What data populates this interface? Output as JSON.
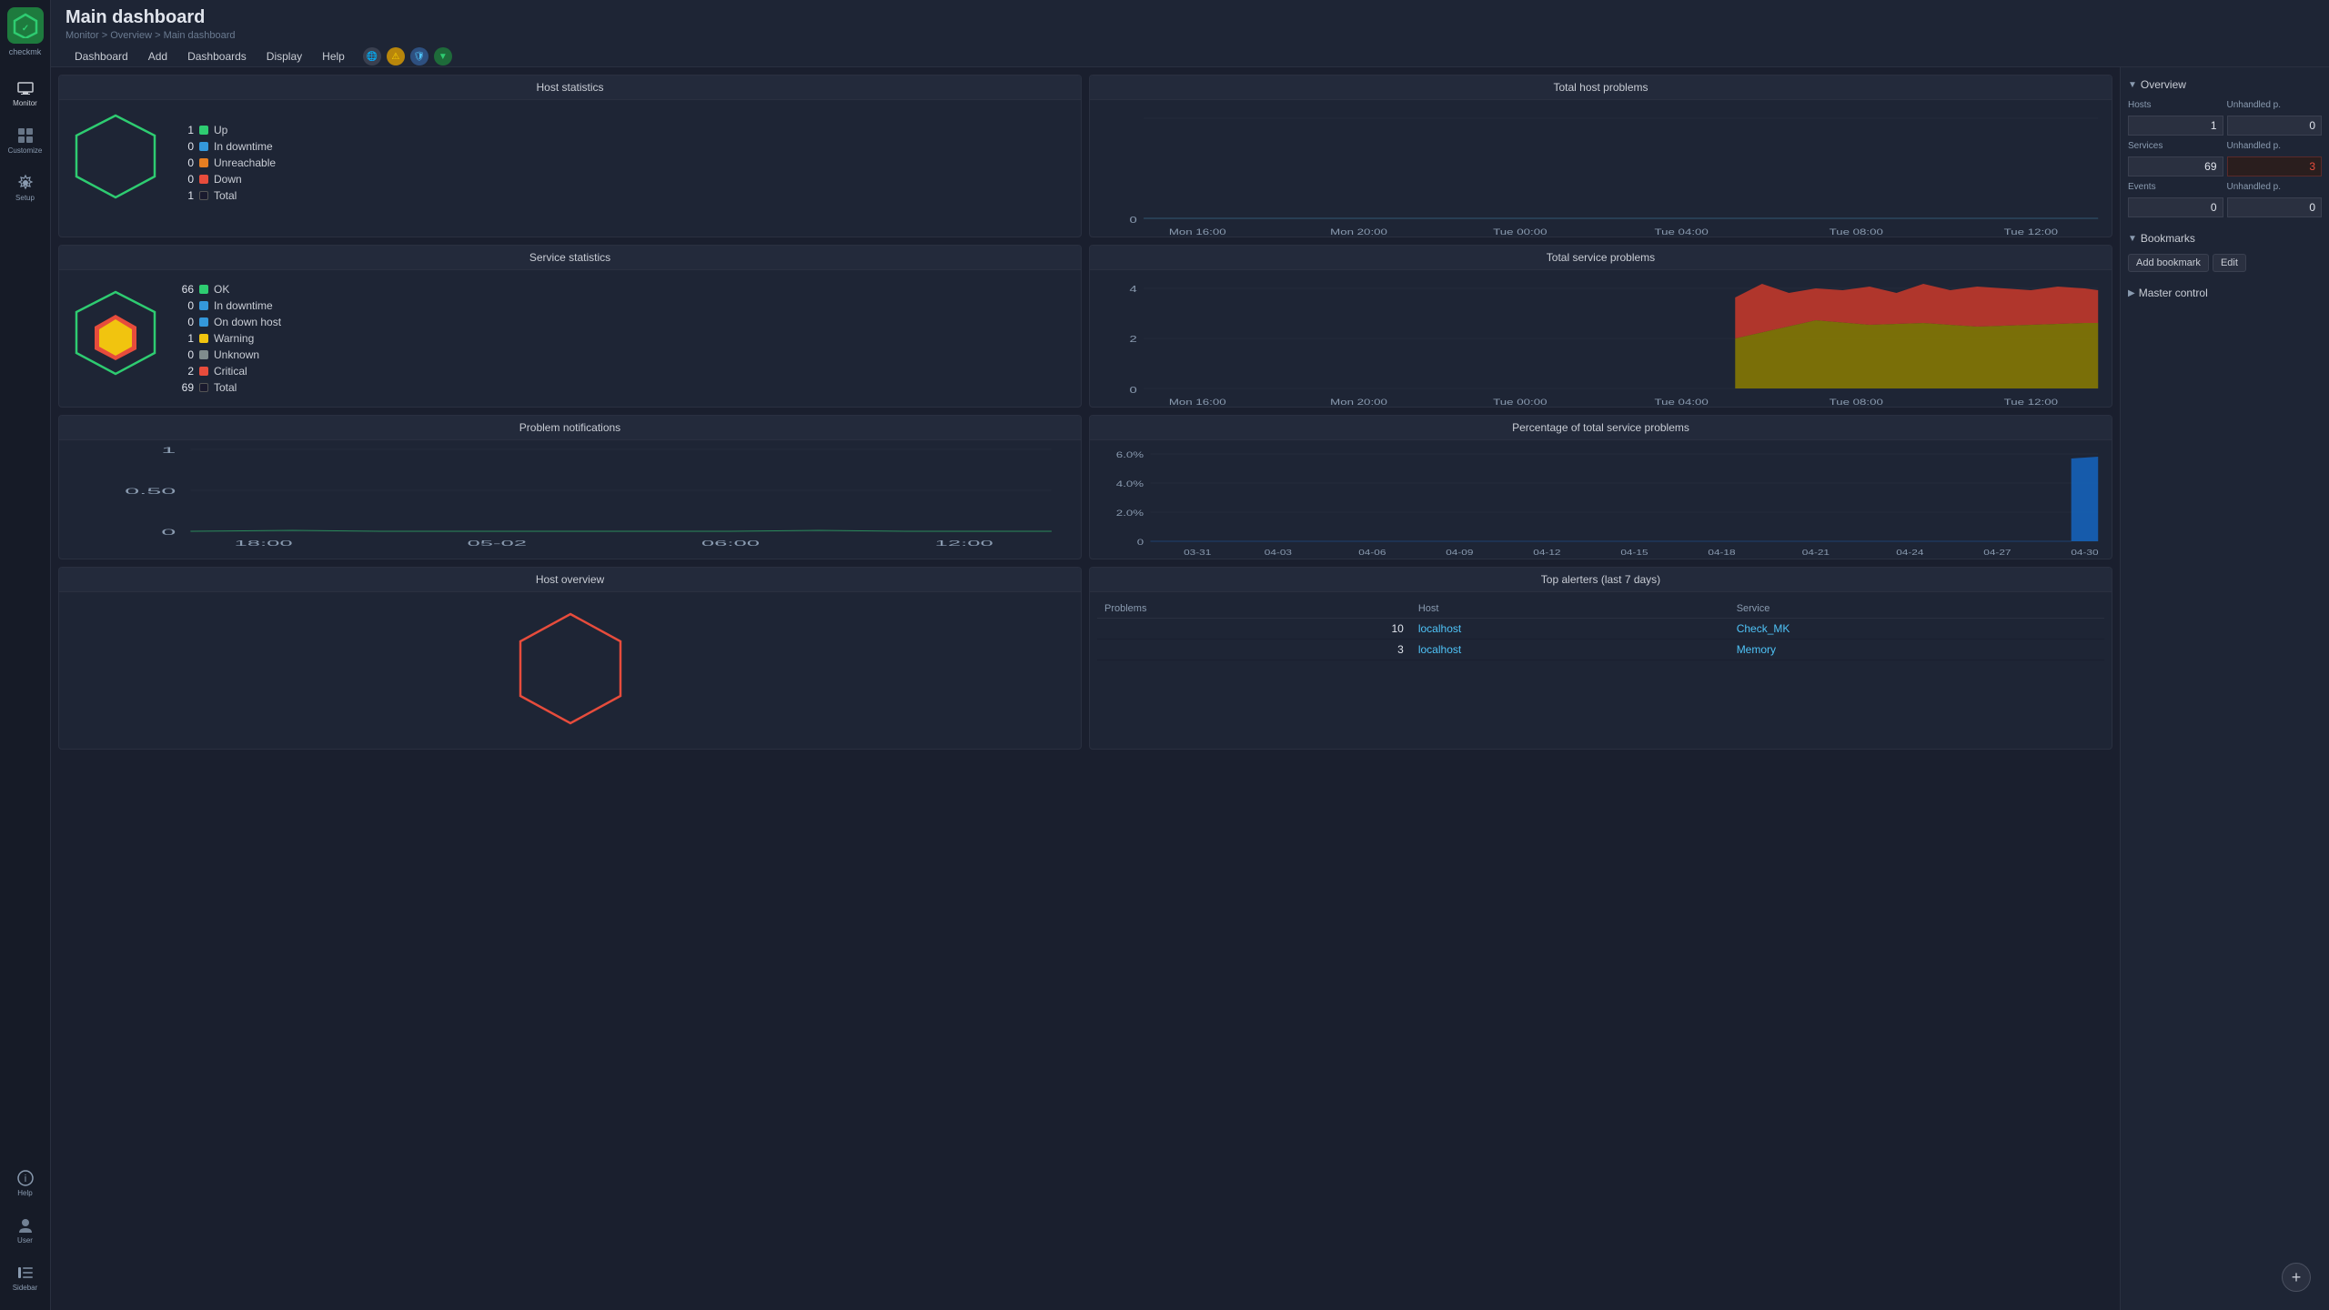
{
  "app": {
    "name": "checkmk",
    "logo_text": "checkmk"
  },
  "nav": {
    "items": [
      {
        "id": "monitor",
        "label": "Monitor",
        "active": true
      },
      {
        "id": "customize",
        "label": "Customize",
        "active": false
      },
      {
        "id": "setup",
        "label": "Setup",
        "active": false
      },
      {
        "id": "help",
        "label": "Help",
        "active": false
      },
      {
        "id": "user",
        "label": "User",
        "active": false
      },
      {
        "id": "sidebar",
        "label": "Sidebar",
        "active": false
      }
    ]
  },
  "header": {
    "title": "Main dashboard",
    "breadcrumb": "Monitor > Overview > Main dashboard",
    "menu_items": [
      "Dashboard",
      "Add",
      "Dashboards",
      "Display",
      "Help"
    ]
  },
  "panels": {
    "host_statistics": {
      "title": "Host statistics",
      "stats": [
        {
          "num": "1",
          "color": "green",
          "label": "Up"
        },
        {
          "num": "0",
          "color": "blue",
          "label": "In downtime"
        },
        {
          "num": "0",
          "color": "orange",
          "label": "Unreachable"
        },
        {
          "num": "0",
          "color": "red",
          "label": "Down"
        },
        {
          "num": "1",
          "color": "black",
          "label": "Total"
        }
      ]
    },
    "service_statistics": {
      "title": "Service statistics",
      "stats": [
        {
          "num": "66",
          "color": "green",
          "label": "OK"
        },
        {
          "num": "0",
          "color": "blue",
          "label": "In downtime"
        },
        {
          "num": "0",
          "color": "blue",
          "label": "On down host"
        },
        {
          "num": "1",
          "color": "yellow",
          "label": "Warning"
        },
        {
          "num": "0",
          "color": "grey",
          "label": "Unknown"
        },
        {
          "num": "2",
          "color": "red",
          "label": "Critical"
        },
        {
          "num": "69",
          "color": "black",
          "label": "Total"
        }
      ]
    },
    "total_host_problems": {
      "title": "Total host problems",
      "x_labels": [
        "Mon 16:00",
        "Mon 20:00",
        "Tue 00:00",
        "Tue 04:00",
        "Tue 08:00",
        "Tue 12:00"
      ],
      "y_max": 0
    },
    "total_service_problems": {
      "title": "Total service problems",
      "x_labels": [
        "Mon 16:00",
        "Mon 20:00",
        "Tue 00:00",
        "Tue 04:00",
        "Tue 08:00",
        "Tue 12:00"
      ],
      "y_labels": [
        "0",
        "2",
        "4"
      ]
    },
    "problem_notifications": {
      "title": "Problem notifications",
      "x_labels": [
        "18:00",
        "05-02",
        "06:00",
        "12:00"
      ],
      "y_labels": [
        "0",
        "0.50",
        "1"
      ]
    },
    "pct_service_problems": {
      "title": "Percentage of total service problems",
      "x_labels": [
        "03-31",
        "04-03",
        "04-06",
        "04-09",
        "04-12",
        "04-15",
        "04-18",
        "04-21",
        "04-24",
        "04-27",
        "04-30"
      ],
      "y_labels": [
        "0",
        "2.0%",
        "4.0%",
        "6.0%"
      ]
    },
    "host_overview": {
      "title": "Host overview"
    },
    "top_alerters": {
      "title": "Top alerters (last 7 days)",
      "columns": [
        "Problems",
        "Host",
        "Service"
      ],
      "rows": [
        {
          "problems": "10",
          "host": "localhost",
          "service": "Check_MK"
        },
        {
          "problems": "3",
          "host": "localhost",
          "service": "Memory"
        }
      ]
    }
  },
  "right_sidebar": {
    "overview": {
      "title": "Overview",
      "rows": [
        {
          "label": "Hosts",
          "value": "1",
          "label2": "Unhandled p.",
          "value2": "0"
        },
        {
          "label": "Services",
          "value": "69",
          "label2": "Unhandled p.",
          "value2": "3"
        },
        {
          "label": "Events",
          "value": "0",
          "label2": "Unhandled p.",
          "value2": "0"
        }
      ]
    },
    "bookmarks": {
      "title": "Bookmarks",
      "buttons": [
        "Add bookmark",
        "Edit"
      ]
    },
    "master_control": {
      "title": "Master control"
    }
  }
}
